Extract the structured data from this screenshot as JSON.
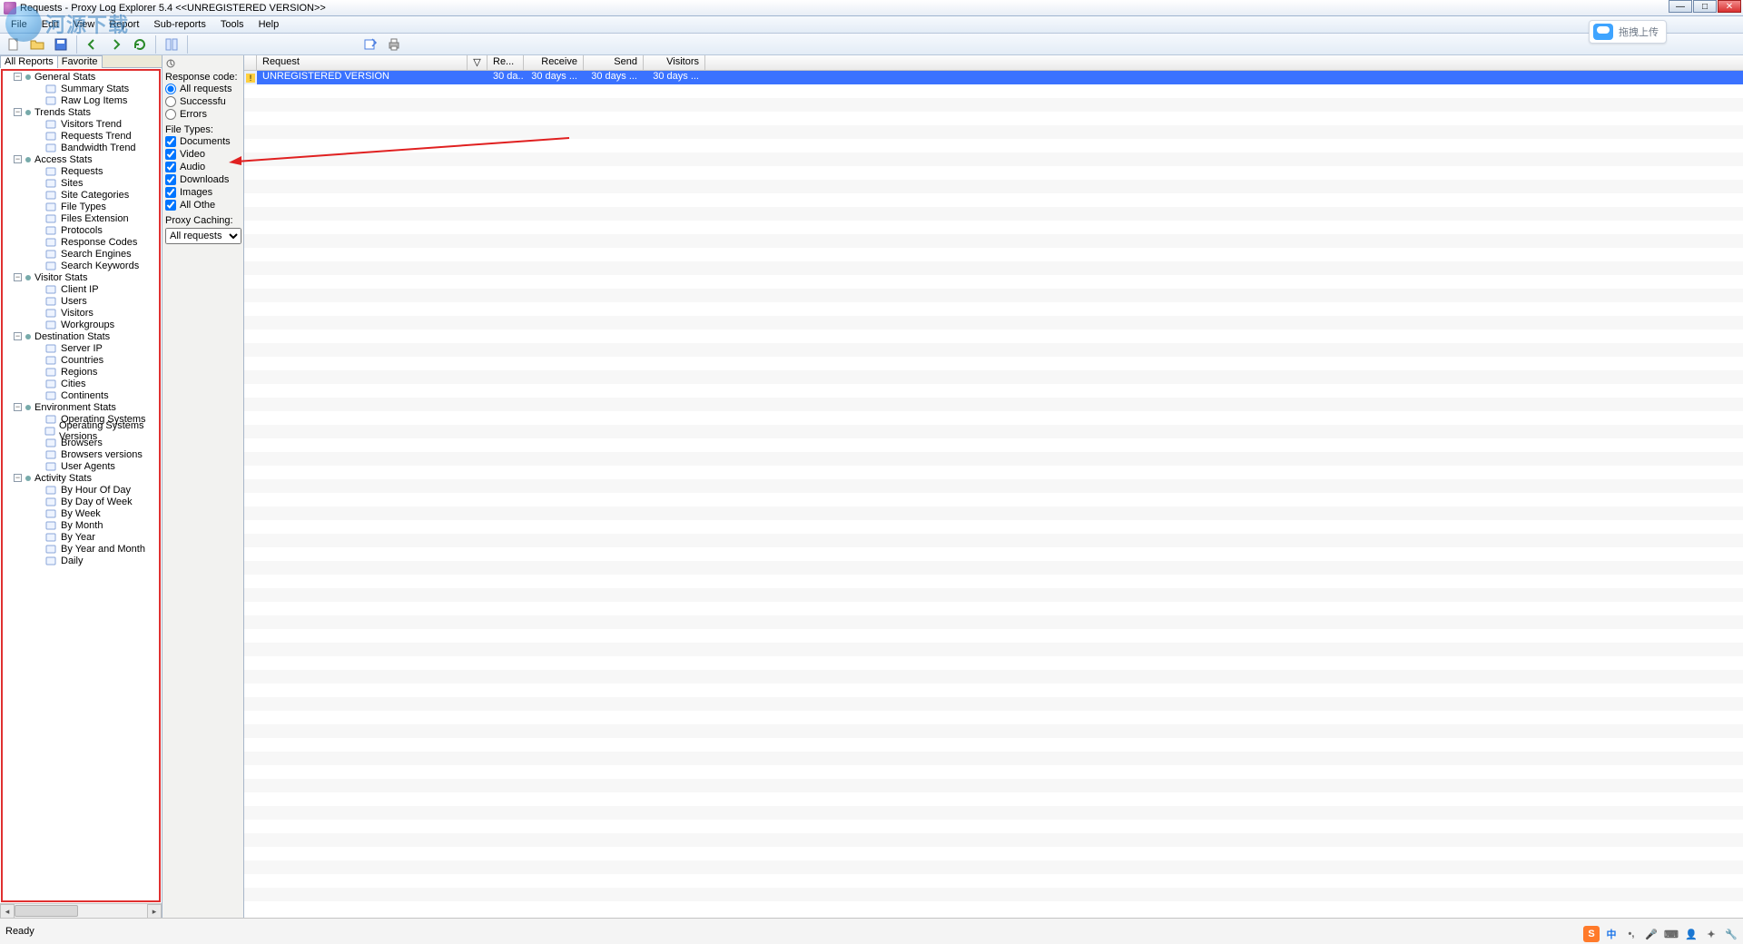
{
  "window": {
    "title": "Requests - Proxy Log Explorer 5.4 <<UNREGISTERED VERSION>>"
  },
  "upload_badge": {
    "label": "拖拽上传"
  },
  "menu": {
    "items": [
      "File",
      "Edit",
      "View",
      "Report",
      "Sub-reports",
      "Tools",
      "Help"
    ]
  },
  "left_tabs": {
    "all": "All Reports",
    "fav": "Favorite"
  },
  "tree": [
    {
      "group": "General Stats",
      "items": [
        "Summary Stats",
        "Raw Log Items"
      ]
    },
    {
      "group": "Trends Stats",
      "items": [
        "Visitors Trend",
        "Requests Trend",
        "Bandwidth Trend"
      ]
    },
    {
      "group": "Access Stats",
      "items": [
        "Requests",
        "Sites",
        "Site Categories",
        "File Types",
        "Files Extension",
        "Protocols",
        "Response Codes",
        "Search Engines",
        "Search Keywords"
      ]
    },
    {
      "group": "Visitor Stats",
      "items": [
        "Client IP",
        "Users",
        "Visitors",
        "Workgroups"
      ]
    },
    {
      "group": "Destination Stats",
      "items": [
        "Server IP",
        "Countries",
        "Regions",
        "Cities",
        "Continents"
      ]
    },
    {
      "group": "Environment Stats",
      "items": [
        "Operating Systems",
        "Operating Systems Versions",
        "Browsers",
        "Browsers versions",
        "User Agents"
      ]
    },
    {
      "group": "Activity Stats",
      "items": [
        "By Hour Of Day",
        "By Day of Week",
        "By Week",
        "By Month",
        "By Year",
        "By Year and Month",
        "Daily"
      ]
    }
  ],
  "filter": {
    "response_code_label": "Response code:",
    "radios": {
      "all": "All requests",
      "success": "Successfu",
      "errors": "Errors"
    },
    "file_types_label": "File Types:",
    "checks": {
      "documents": "Documents",
      "video": "Video",
      "audio": "Audio",
      "downloads": "Downloads",
      "images": "Images",
      "other": "All Othe"
    },
    "proxy_caching_label": "Proxy Caching:",
    "proxy_caching_value": "All requests"
  },
  "grid": {
    "columns": {
      "request": "Request",
      "filter": "▽",
      "re": "Re...",
      "receive": "Receive",
      "send": "Send",
      "visitors": "Visitors"
    },
    "row": {
      "request": "UNREGISTERED VERSION",
      "re": "30 da..",
      "receive": "30 days ...",
      "send": "30 days ...",
      "visitors": "30 days ..."
    }
  },
  "status": {
    "ready": "Ready",
    "ime": "中",
    "s": "S"
  }
}
